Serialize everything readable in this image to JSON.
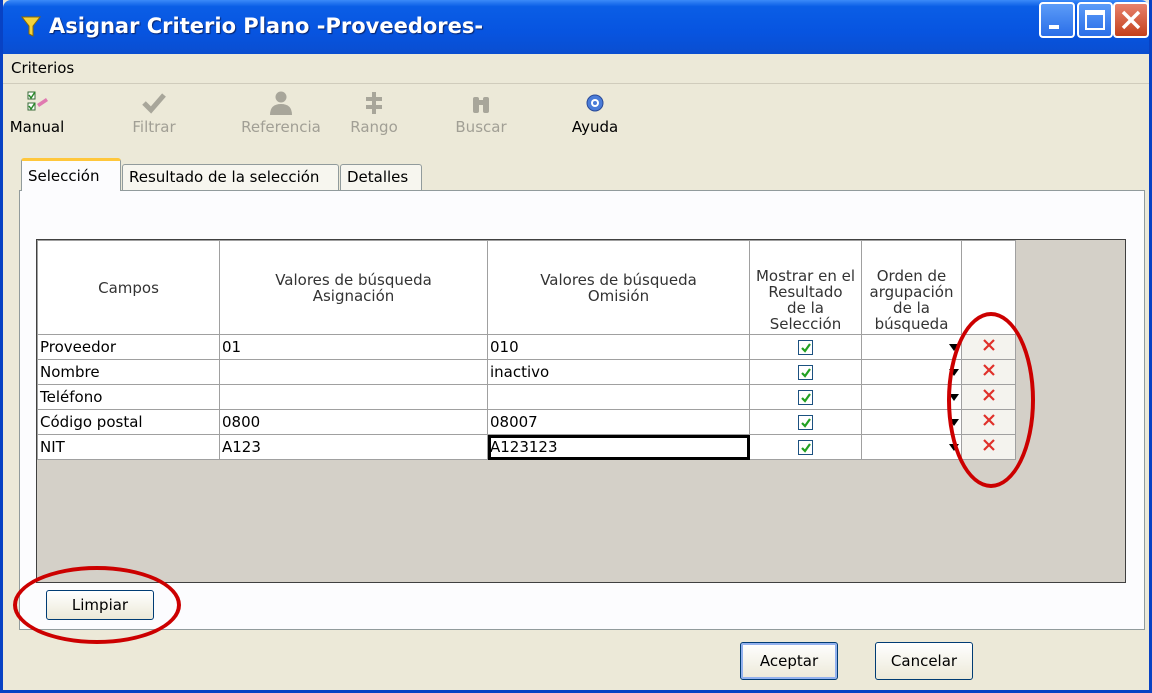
{
  "window": {
    "title": "Asignar Criterio Plano -Proveedores-"
  },
  "menu": {
    "criterios": "Criterios"
  },
  "toolbar": {
    "manual": "Manual",
    "filtrar": "Filtrar",
    "referencia": "Referencia",
    "rango": "Rango",
    "buscar": "Buscar",
    "ayuda": "Ayuda"
  },
  "tabs": {
    "seleccion": "Selección",
    "resultado": "Resultado de la selección",
    "detalles": "Detalles"
  },
  "grid": {
    "headers": {
      "campos": "Campos",
      "asignacion_line1": "Valores de búsqueda",
      "asignacion_line2": "Asignación",
      "omision_line1": "Valores de búsqueda",
      "omision_line2": "Omisión",
      "mostrar_line1": "Mostrar en el",
      "mostrar_line2": "Resultado",
      "mostrar_line3": "de la",
      "mostrar_line4": "Selección",
      "orden_line1": "Orden de",
      "orden_line2": "argupación",
      "orden_line3": "de la",
      "orden_line4": "búsqueda"
    },
    "rows": [
      {
        "campo": "Proveedor",
        "asignacion": "01",
        "omision": "010",
        "mostrar": true
      },
      {
        "campo": "Nombre",
        "asignacion": "",
        "omision": "inactivo",
        "mostrar": true
      },
      {
        "campo": "Teléfono",
        "asignacion": "",
        "omision": "",
        "mostrar": true
      },
      {
        "campo": "Código postal",
        "asignacion": "0800",
        "omision": "08007",
        "mostrar": true
      },
      {
        "campo": "NIT",
        "asignacion": "A123",
        "omision": "A123123",
        "mostrar": true
      }
    ]
  },
  "buttons": {
    "limpiar": "Limpiar",
    "aceptar": "Aceptar",
    "cancelar": "Cancelar"
  },
  "colors": {
    "titlebar": "#0754e0",
    "window_bg": "#ece9d8",
    "annotation": "#cc0000",
    "delete_x": "#e0302a",
    "checkmark": "#21a121"
  }
}
